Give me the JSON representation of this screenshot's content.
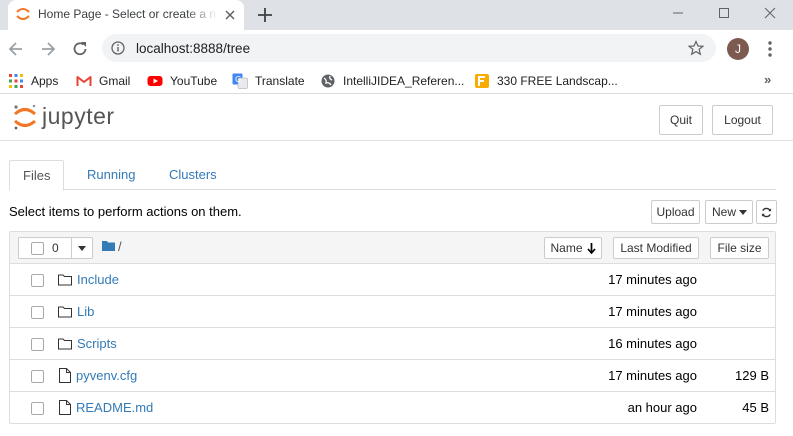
{
  "browser": {
    "tab": {
      "title": "Home Page - Select or create a notebook"
    },
    "address": {
      "url": "localhost:8888/tree"
    },
    "profile": {
      "initial": "J"
    },
    "bookmarks": [
      {
        "label": "Apps",
        "icon": "apps-grid-icon"
      },
      {
        "label": "Gmail",
        "icon": "gmail-icon"
      },
      {
        "label": "YouTube",
        "icon": "youtube-icon"
      },
      {
        "label": "Translate",
        "icon": "translate-icon"
      },
      {
        "label": "IntelliJIDEA_Referen...",
        "icon": "globe-icon"
      },
      {
        "label": "330 FREE Landscap...",
        "icon": "bookmark-f-icon"
      }
    ],
    "more_bookmarks": "»"
  },
  "jupyter": {
    "logo_text": "jupyter",
    "header_buttons": {
      "quit": "Quit",
      "logout": "Logout"
    },
    "tabs": [
      {
        "label": "Files",
        "active": true
      },
      {
        "label": "Running",
        "active": false
      },
      {
        "label": "Clusters",
        "active": false
      }
    ],
    "hint": "Select items to perform actions on them.",
    "actions": {
      "upload": "Upload",
      "new": "New"
    },
    "list_header": {
      "selected_count": "0",
      "path": "/",
      "sort_name": "Name",
      "sort_modified": "Last Modified",
      "sort_size": "File size"
    },
    "files": [
      {
        "name": "Include",
        "type": "folder",
        "modified": "17 minutes ago",
        "size": ""
      },
      {
        "name": "Lib",
        "type": "folder",
        "modified": "17 minutes ago",
        "size": ""
      },
      {
        "name": "Scripts",
        "type": "folder",
        "modified": "16 minutes ago",
        "size": ""
      },
      {
        "name": "pyvenv.cfg",
        "type": "file",
        "modified": "17 minutes ago",
        "size": "129 B"
      },
      {
        "name": "README.md",
        "type": "file",
        "modified": "an hour ago",
        "size": "45 B"
      }
    ],
    "colors": {
      "link": "#337ab7",
      "brand_orange": "#f37626"
    }
  }
}
